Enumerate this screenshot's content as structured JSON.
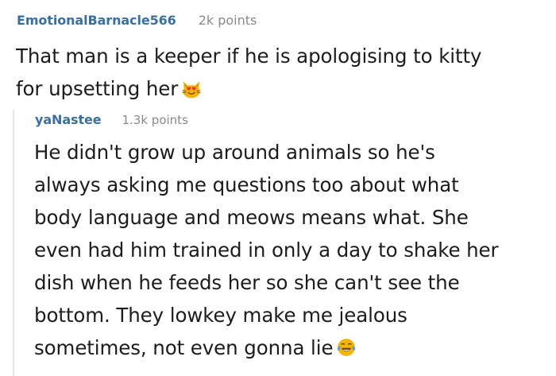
{
  "comment": {
    "author": "EmotionalBarnacle566",
    "points": "2k points",
    "lines": [
      "That man is a keeper if he is apologising to kitty",
      "for upsetting her"
    ],
    "emoji": "heart-eyes-cat-icon"
  },
  "reply": {
    "author": "yaNastee",
    "points": "1.3k points",
    "lines": [
      "He didn't grow up around animals so he's",
      "always asking me questions too about what",
      "body language and meows means what. She",
      "even had him trained in only a day to shake her",
      "dish when he feeds her so she can't see the",
      "bottom. They lowkey make me jealous",
      "sometimes, not even gonna lie"
    ],
    "emoji": "tears-of-joy-icon"
  },
  "colors": {
    "author": "#3a6fa6",
    "points": "#8a8a8a",
    "text": "#1c1c1c",
    "thread_line": "#e6e6e6"
  }
}
